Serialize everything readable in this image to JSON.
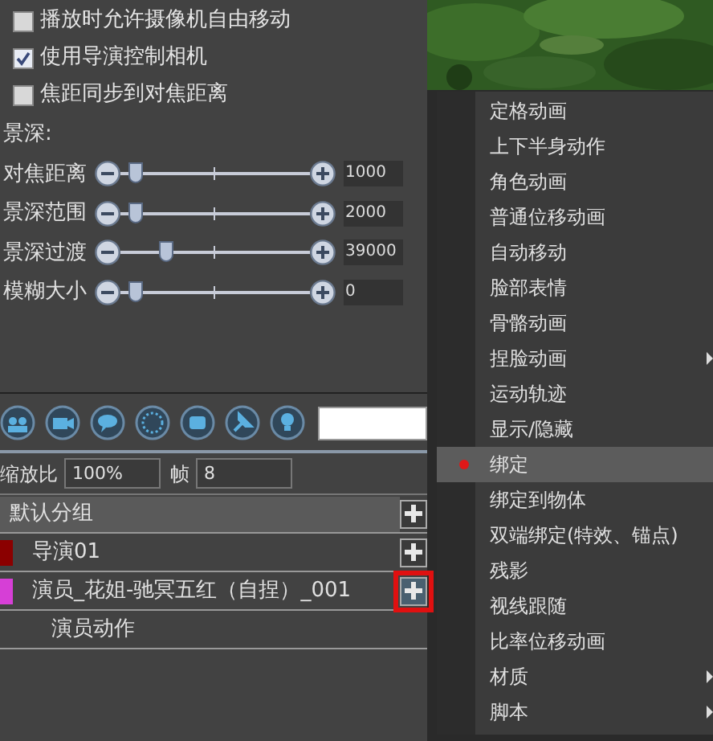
{
  "options": [
    {
      "label": "播放时允许摄像机自由移动",
      "checked": false
    },
    {
      "label": "使用导演控制相机",
      "checked": true
    },
    {
      "label": "焦距同步到对焦距离",
      "checked": false
    }
  ],
  "depth_of_field": {
    "title": "景深:",
    "sliders": [
      {
        "label": "对焦距离",
        "level": 0.05,
        "value": "1000"
      },
      {
        "label": "景深范围",
        "level": 0.05,
        "value": "2000"
      },
      {
        "label": "景深过渡",
        "level": 0.22,
        "value": "39000"
      },
      {
        "label": "模糊大小",
        "level": 0.05,
        "value": "0"
      }
    ]
  },
  "zoom": {
    "label": "缩放比",
    "value": "100%"
  },
  "frame": {
    "label": "帧",
    "value": "8"
  },
  "tracks": [
    {
      "kind": "group",
      "label": "默认分组",
      "add": true,
      "highlighted": false
    },
    {
      "kind": "track",
      "label": "导演01",
      "color": "#8b0000",
      "add": true,
      "highlighted": false
    },
    {
      "kind": "track",
      "label": "演员_花姐-驰冥五红（自捏）_001",
      "color": "#d63fd6",
      "add": true,
      "highlighted": true
    },
    {
      "kind": "sub",
      "label": "演员动作",
      "add": false,
      "highlighted": false
    }
  ],
  "context_menu": {
    "items": [
      {
        "label": "定格动画",
        "selected": false,
        "submenu": false
      },
      {
        "label": "上下半身动作",
        "selected": false,
        "submenu": false
      },
      {
        "label": "角色动画",
        "selected": false,
        "submenu": false
      },
      {
        "label": "普通位移动画",
        "selected": false,
        "submenu": false
      },
      {
        "label": "自动移动",
        "selected": false,
        "submenu": false
      },
      {
        "label": "脸部表情",
        "selected": false,
        "submenu": false
      },
      {
        "label": "骨骼动画",
        "selected": false,
        "submenu": false
      },
      {
        "label": "捏脸动画",
        "selected": false,
        "submenu": true
      },
      {
        "label": "运动轨迹",
        "selected": false,
        "submenu": false
      },
      {
        "label": "显示/隐藏",
        "selected": false,
        "submenu": false
      },
      {
        "label": "绑定",
        "selected": true,
        "submenu": false
      },
      {
        "label": "绑定到物体",
        "selected": false,
        "submenu": false
      },
      {
        "label": "双端绑定(特效、锚点)",
        "selected": false,
        "submenu": false
      },
      {
        "label": "残影",
        "selected": false,
        "submenu": false
      },
      {
        "label": "视线跟随",
        "selected": false,
        "submenu": false
      },
      {
        "label": "比率位移动画",
        "selected": false,
        "submenu": false
      },
      {
        "label": "材质",
        "selected": false,
        "submenu": true
      },
      {
        "label": "脚本",
        "selected": false,
        "submenu": true
      }
    ]
  }
}
